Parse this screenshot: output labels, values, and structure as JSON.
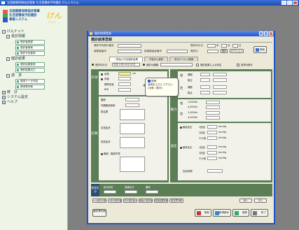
{
  "app": {
    "window_title": "全国健康保険協会管掌 生活習慣病予防健診 けんシステム",
    "brand_lines": [
      "全国健康保険協会管掌",
      "生活習慣病予防健診",
      "事業システム"
    ],
    "logo_text": "けん",
    "logo_sub": "ナット"
  },
  "sidebar": {
    "root": "けんナット",
    "groups": [
      {
        "label": "受診情報",
        "items": [
          "受診者登録",
          "受診者検索",
          "受診予定登録"
        ]
      },
      {
        "label": "健診結果",
        "items": [
          "健診結果登録",
          "健診結果出力"
        ]
      },
      {
        "label": "請　求",
        "items": [
          "請求データ作成",
          "請求書印刷"
        ]
      }
    ],
    "more": [
      "統　計",
      "システム設定",
      "ヘルプ"
    ]
  },
  "dialog": {
    "title": "健診結果登録",
    "form_title": "健診結果登録",
    "meta": {
      "l1": "健診予約受付番号",
      "l2": "保険者番号",
      "l3": "被保険者証番号",
      "l4": "受診年月日",
      "l5": "受診日",
      "date_sep": [
        "年",
        "月",
        "日"
      ],
      "btn_select": "選択",
      "btn_option": "オプション",
      "search_btn": "検索"
    },
    "tabs": [
      "一般及び付加健診結果",
      "子宮がん検診",
      "肝炎ウイルス検査"
    ],
    "options": {
      "o1": "受診年月日",
      "o1_val": "平成 21年 01月 01日",
      "o2": "健診の種類",
      "o3": "健診結果による判定",
      "o4": "請求対象外"
    },
    "left": {
      "labels": [
        "身長",
        "体重",
        "標準体重",
        "BMI",
        "腹囲",
        "内臓脂肪面積",
        "既往歴",
        "自覚症状",
        "他覚症状",
        "胸部・腹部所見"
      ],
      "section_labels": [
        "計測",
        "診察"
      ],
      "height_unit": "cm"
    },
    "tooltip": {
      "lines": [
        "説明",
        "身長を入力して下さい",
        "(半角／数字)"
      ]
    },
    "right": {
      "section_labels": [
        "視力",
        "聴力",
        "血圧"
      ],
      "eye": {
        "side_r": "右",
        "side_l": "左",
        "rows": [
          "裸眼",
          "矯正"
        ]
      },
      "ear": {
        "side_r": "右",
        "side_l": "左",
        "rows": [
          "1,000Hz",
          "4,000Hz"
        ]
      },
      "bp": {
        "rows": [
          "最高血圧",
          "最低血圧"
        ],
        "sub": [
          "1回目",
          "2回目",
          "その他"
        ],
        "unit": "mmHg",
        "last": "採血時間"
      }
    },
    "summary": {
      "label": "指導区分",
      "items": [
        "総合判定",
        "指導区分",
        "備考"
      ]
    },
    "nav": [
      "<<最初の受診者",
      "<前の受診者",
      "次の受診者>",
      "最後の受診者>>",
      "前回結果参照",
      "受診票印刷",
      "前へ",
      "次へ"
    ],
    "actions": {
      "print": "健診票印刷",
      "delete": "削除",
      "save_new": "新規保存",
      "save": "登録",
      "close": "終了"
    },
    "colors": {
      "panel": "#5c7e57",
      "title": "#2054c4",
      "highlight": "#fff36a"
    }
  }
}
